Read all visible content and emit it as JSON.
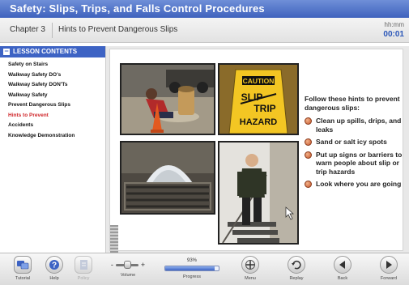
{
  "app": {
    "title": "Safety: Slips, Trips, and Falls Control Procedures"
  },
  "chapter": {
    "number": "Chapter 3",
    "title": "Hints to Prevent Dangerous Slips"
  },
  "timer": {
    "label": "hh:mm",
    "value": "00:01"
  },
  "sidebar": {
    "heading": "LESSON CONTENTS",
    "items": [
      {
        "label": "Safety on Stairs",
        "active": false
      },
      {
        "label": "Walkway Safety DO's",
        "active": false
      },
      {
        "label": "Walkway Safety DON'Ts",
        "active": false
      },
      {
        "label": "Walkway Safety",
        "active": false
      },
      {
        "label": "Prevent Dangerous Slips",
        "active": false
      },
      {
        "label": "Hints to Prevent",
        "active": true
      },
      {
        "label": "Accidents",
        "active": false
      },
      {
        "label": "Knowledge Demonstration",
        "active": false
      }
    ]
  },
  "slide": {
    "intro": "Follow these hints to prevent dangerous slips:",
    "hints": [
      "Clean up spills, drips, and leaks",
      "Sand or salt icy spots",
      "Put up signs or barriers to warn people about slip or trip hazards",
      "Look where you are going"
    ],
    "sign": {
      "line1": "CAUTION",
      "line2": "SLIP",
      "line3": "TRIP",
      "line4": "HAZARD"
    },
    "bullet_color": "#d4673a"
  },
  "toolbar": {
    "tutorial": "Tutorial",
    "help": "Help",
    "policy": "Policy",
    "volume": "Volume",
    "volume_minus": "-",
    "volume_plus": "+",
    "progress_label": "Progress",
    "progress_pct": "93%",
    "progress_value": 0.93,
    "menu": "Menu",
    "replay": "Replay",
    "back": "Back",
    "forward": "Forward"
  },
  "colors": {
    "accent": "#3d63c4",
    "active_item": "#d0262a"
  }
}
